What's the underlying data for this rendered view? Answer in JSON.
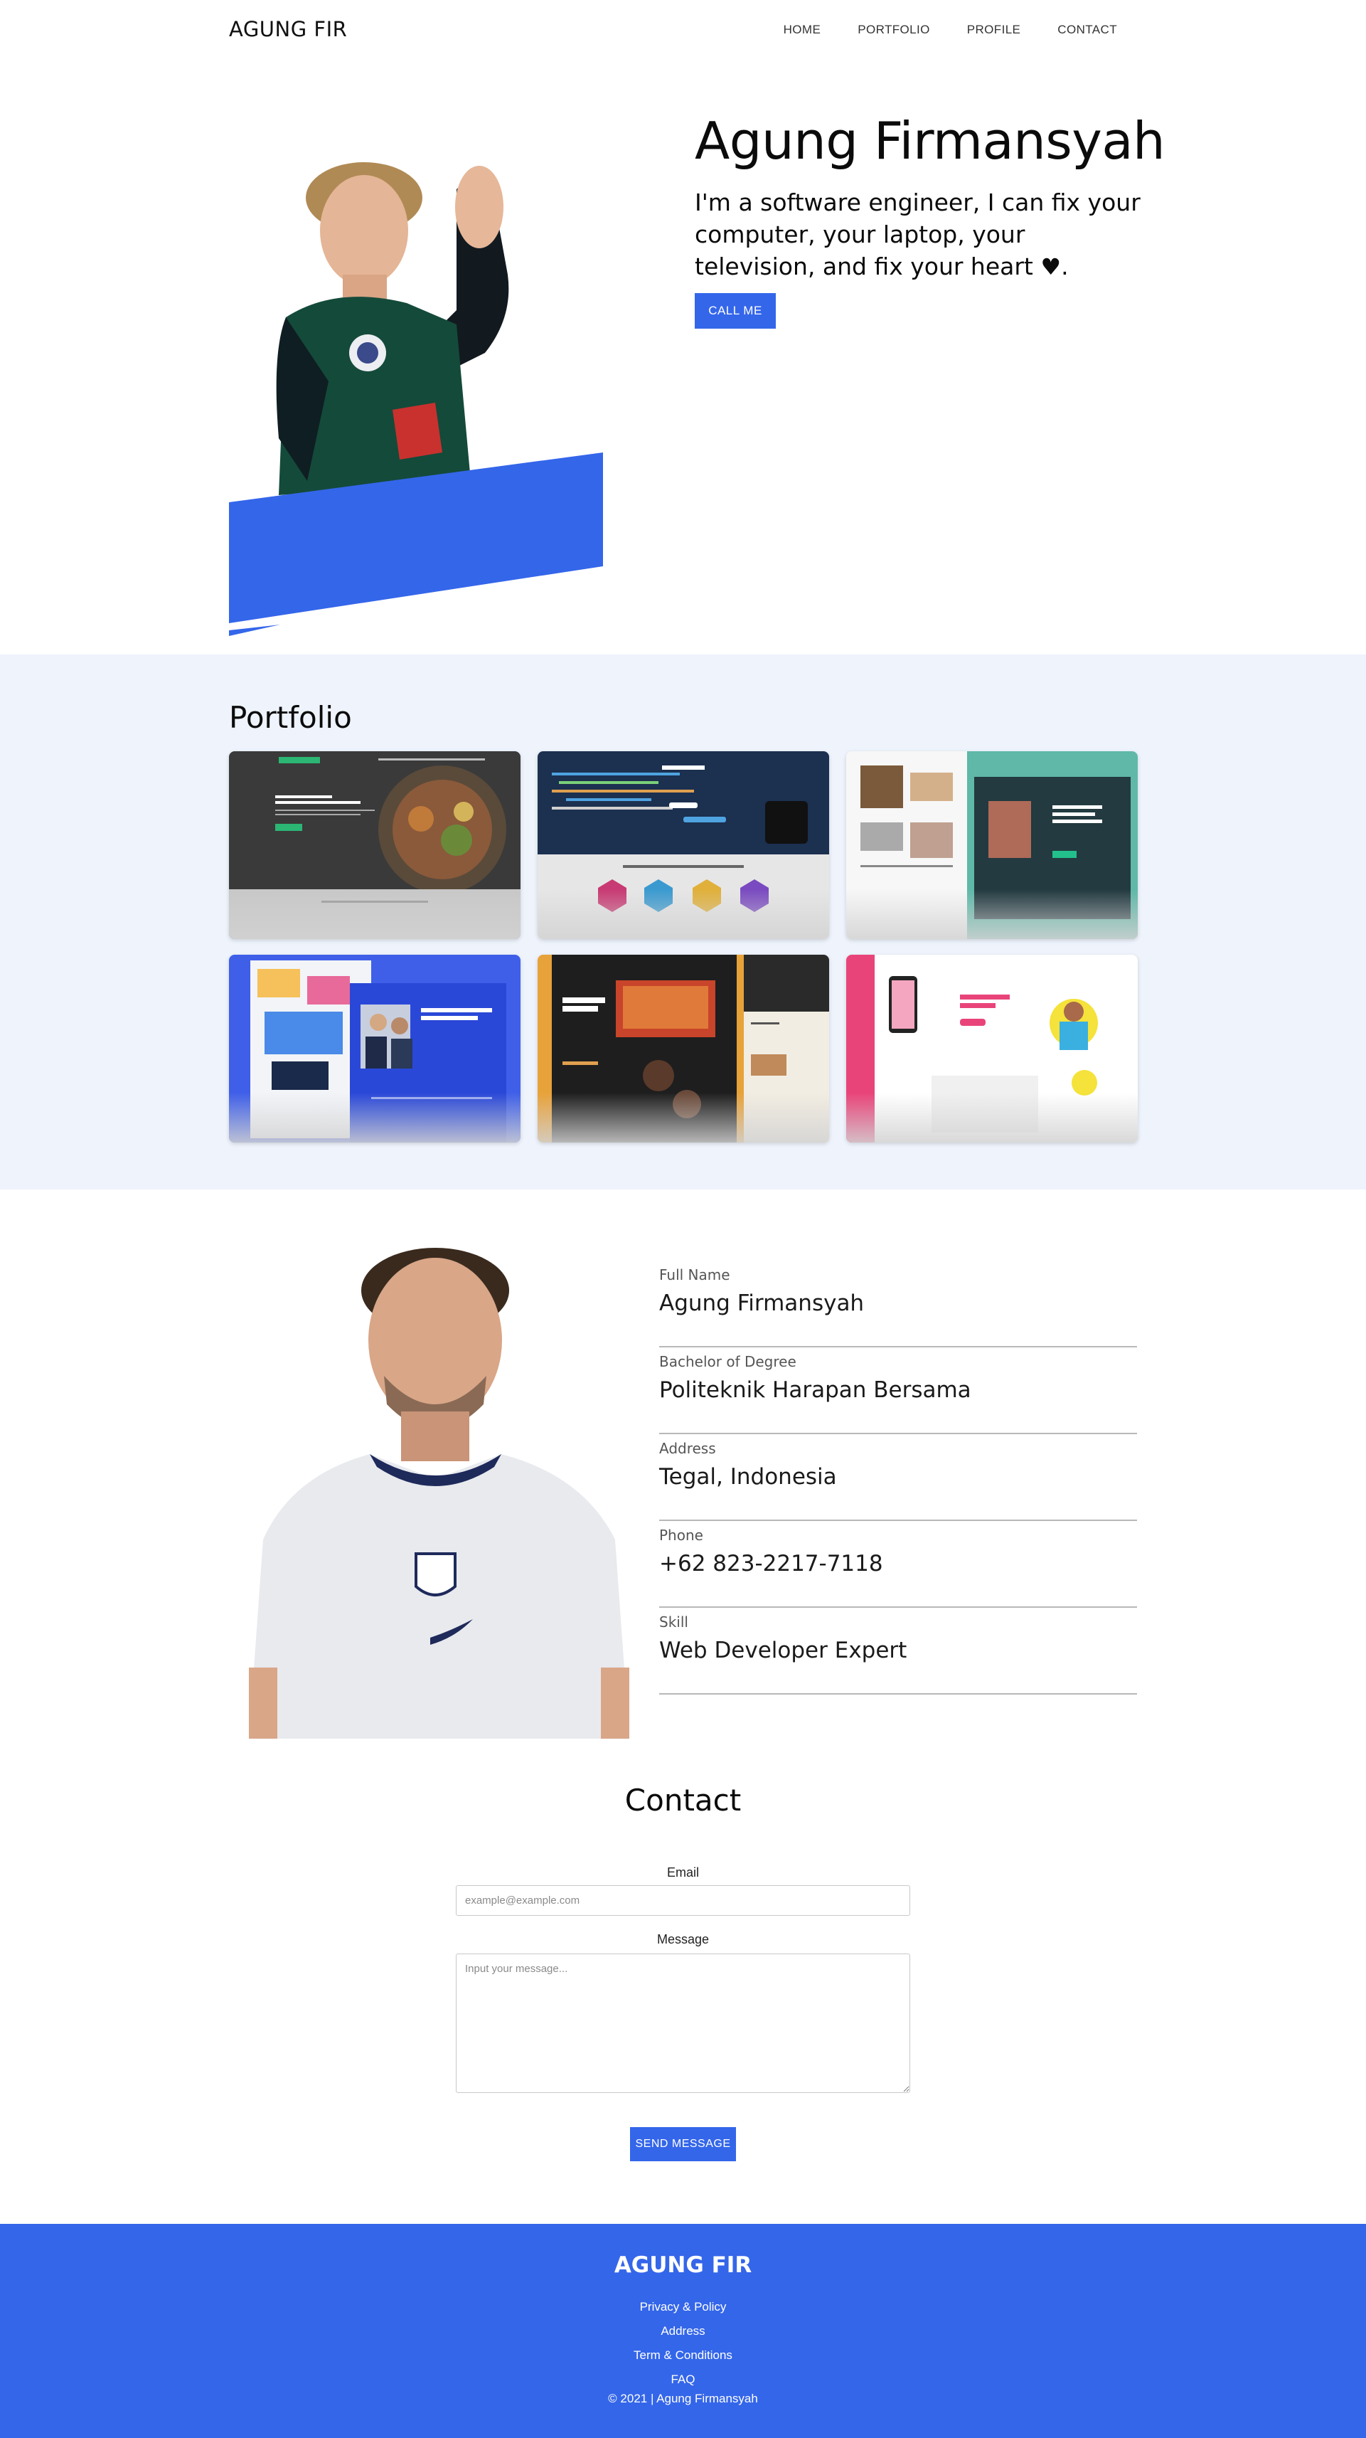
{
  "nav": {
    "brand": "AGUNG FIR",
    "links": [
      "HOME",
      "PORTFOLIO",
      "PROFILE",
      "CONTACT"
    ]
  },
  "hero": {
    "title": "Agung Firmansyah",
    "subtitle": "I'm a software engineer, I can fix your computer, your laptop, your television, and fix your heart",
    "heart_icon": "heart-icon",
    "cta": "CALL ME"
  },
  "portfolio": {
    "title": "Portfolio",
    "items": [
      {
        "heading": "GOODBYE JUNK FOOD. HELLO SUPER HEALTHY MEALS.",
        "brand": "Healthy Food",
        "footer": "HOT FOOD FAST — HOT FAST FOOD"
      },
      {
        "heading": "BELAJAR",
        "subheading": "Langkah Awal Menjadi Web Developer"
      },
      {
        "heading": "Let's Talk About Startups That People Like!",
        "subheading": "Ready to break some ideas soon"
      },
      {
        "heading": "You Put The Best Choice to Trust Us",
        "number": "01"
      },
      {
        "heading": "A Signature of Nature",
        "subheading": "Our Product"
      },
      {
        "heading": "Don't sweat it, we clear it"
      }
    ]
  },
  "profile": {
    "fields": [
      {
        "label": "Full Name",
        "value": "Agung Firmansyah"
      },
      {
        "label": "Bachelor of Degree",
        "value": "Politeknik Harapan Bersama"
      },
      {
        "label": "Address",
        "value": "Tegal, Indonesia"
      },
      {
        "label": "Phone",
        "value": "+62 823-2217-7118"
      },
      {
        "label": "Skill",
        "value": "Web Developer Expert"
      }
    ]
  },
  "contact": {
    "title": "Contact",
    "email_label": "Email",
    "email_placeholder": "example@example.com",
    "message_label": "Message",
    "message_placeholder": "Input your message...",
    "submit": "SEND MESSAGE"
  },
  "footer": {
    "brand": "AGUNG FIR",
    "links": [
      "Privacy & Policy",
      "Address",
      "Term & Conditions",
      "FAQ"
    ],
    "copyright": "© 2021 | Agung Firmansyah"
  },
  "colors": {
    "accent": "#3466ea",
    "portfolio_bg": "#eef3fc"
  }
}
